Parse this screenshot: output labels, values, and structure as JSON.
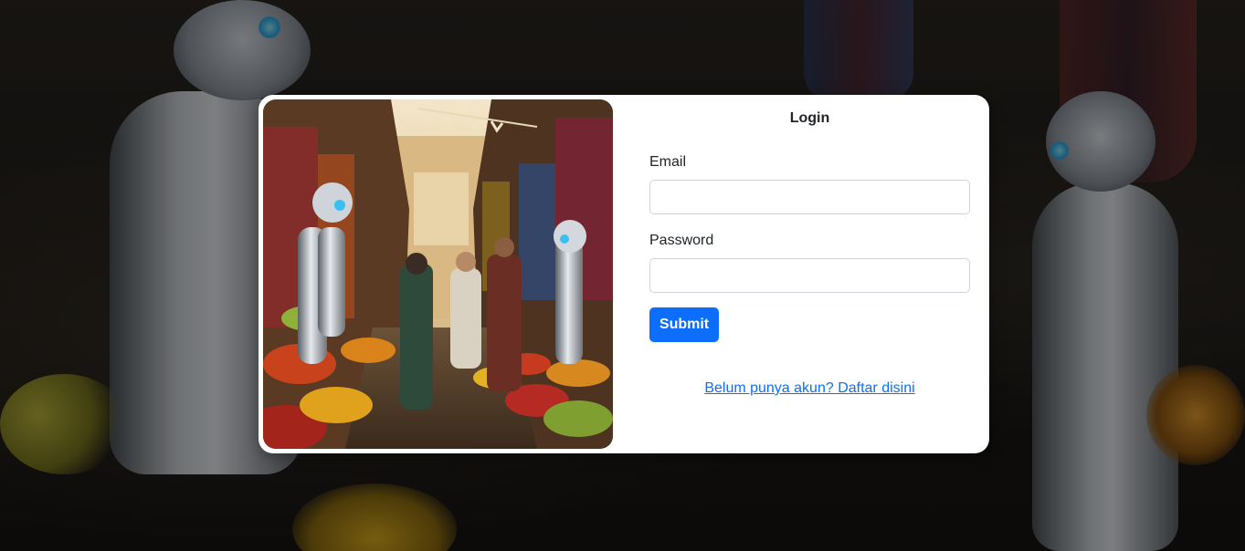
{
  "login": {
    "title": "Login",
    "email_label": "Email",
    "email_value": "",
    "password_label": "Password",
    "password_value": "",
    "submit_label": "Submit",
    "register_link": "Belum punya akun? Daftar disini"
  },
  "colors": {
    "primary": "#0d6efd",
    "card_bg": "#ffffff",
    "text": "#212529",
    "input_border": "#ced4da"
  }
}
